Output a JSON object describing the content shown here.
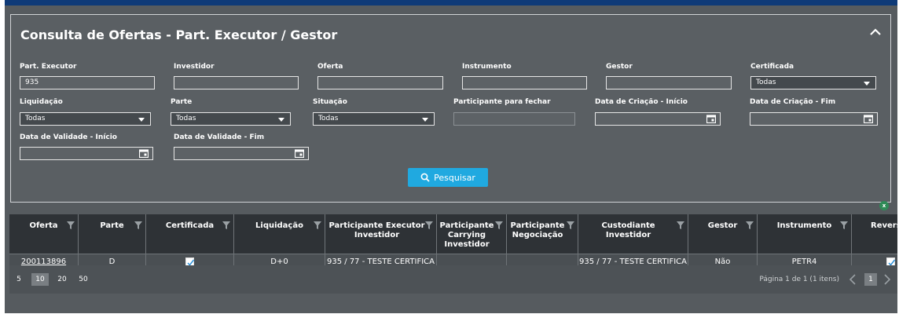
{
  "panel": {
    "title": "Consulta de Ofertas - Part. Executor / Gestor"
  },
  "filters": {
    "part_executor": {
      "label": "Part. Executor",
      "value": "935"
    },
    "investidor": {
      "label": "Investidor",
      "value": ""
    },
    "oferta": {
      "label": "Oferta",
      "value": ""
    },
    "instrumento": {
      "label": "Instrumento",
      "value": ""
    },
    "gestor": {
      "label": "Gestor",
      "value": ""
    },
    "certificada": {
      "label": "Certificada",
      "value": "Todas"
    },
    "liquidacao": {
      "label": "Liquidação",
      "value": "Todas"
    },
    "parte": {
      "label": "Parte",
      "value": "Todas"
    },
    "situacao": {
      "label": "Situação",
      "value": "Todas"
    },
    "participante_fechar": {
      "label": "Participante para fechar",
      "value": ""
    },
    "data_criacao_inicio": {
      "label": "Data de Criação - Início",
      "value": ""
    },
    "data_criacao_fim": {
      "label": "Data de Criação - Fim",
      "value": ""
    },
    "data_validade_inicio": {
      "label": "Data de Validade - Início",
      "value": ""
    },
    "data_validade_fim": {
      "label": "Data de Validade - Fim",
      "value": ""
    }
  },
  "search_button": {
    "label": "Pesquisar"
  },
  "grid": {
    "columns": [
      {
        "key": "oferta",
        "label": "Oferta"
      },
      {
        "key": "parte",
        "label": "Parte"
      },
      {
        "key": "certificada",
        "label": "Certificada"
      },
      {
        "key": "liquidacao",
        "label": "Liquidação"
      },
      {
        "key": "part_exec_inv",
        "label": "Participante Executor Investidor"
      },
      {
        "key": "part_carrying",
        "label": "Participante Carrying Investidor"
      },
      {
        "key": "part_negoc",
        "label": "Participante Negociação"
      },
      {
        "key": "custodiante",
        "label": "Custodiante Investidor"
      },
      {
        "key": "gestor",
        "label": "Gestor"
      },
      {
        "key": "instrumento",
        "label": "Instrumento"
      },
      {
        "key": "revers",
        "label": "Revers"
      }
    ],
    "rows": [
      {
        "oferta": "200113896",
        "parte": "D",
        "certificada": true,
        "liquidacao": "D+0",
        "part_exec_inv": "935 / 77 - TESTE CERTIFICA",
        "part_carrying": "",
        "part_negoc": "",
        "custodiante": "935 / 77 - TESTE CERTIFICA",
        "gestor": "Não",
        "instrumento": "PETR4",
        "revers": true
      }
    ]
  },
  "pager": {
    "sizes": [
      "5",
      "10",
      "20",
      "50"
    ],
    "selected_size": "10",
    "info": "Página 1 de 1 (1 itens)",
    "current_page": "1"
  },
  "colors": {
    "accent": "#20a9e0",
    "header_stripe": "#0e3a78",
    "panel_bg": "#5a5f63"
  }
}
